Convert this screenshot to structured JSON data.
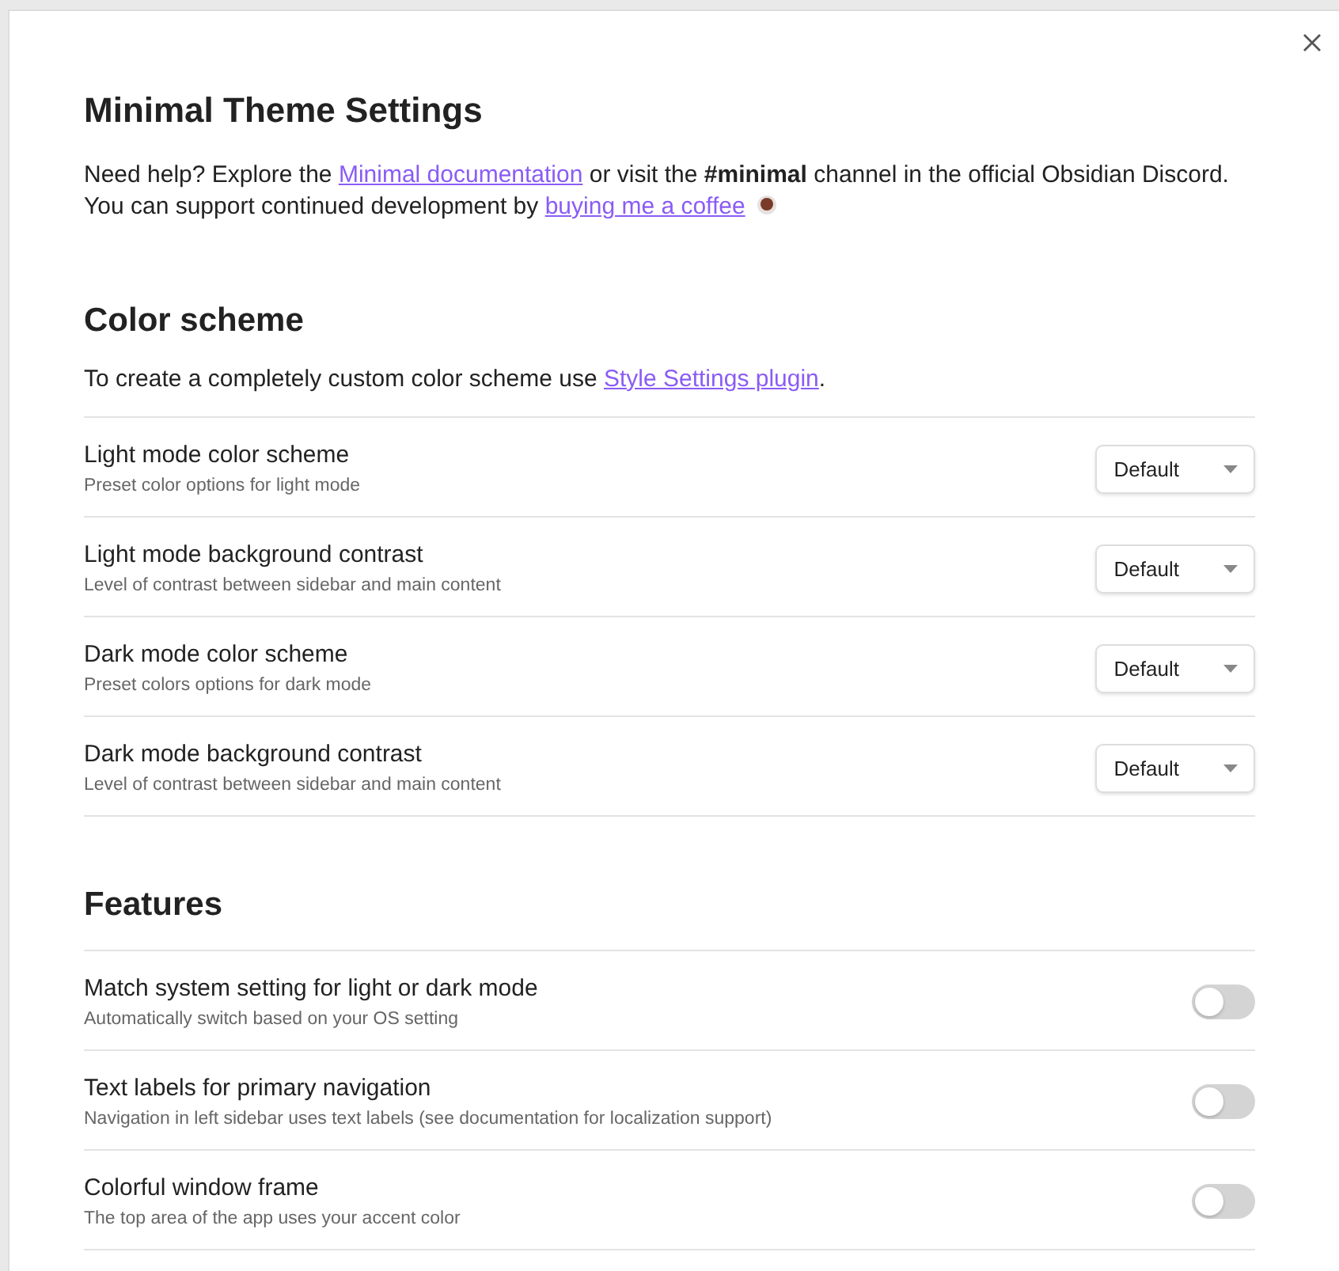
{
  "title": "Minimal Theme Settings",
  "help": [
    [
      {
        "kind": "text",
        "text": "Need help? Explore the "
      },
      {
        "kind": "link",
        "text": "Minimal documentation"
      },
      {
        "kind": "text",
        "text": " or visit the **#minimal** channel in the official Obsidian Discord."
      }
    ],
    [
      {
        "kind": "text",
        "text": "You can support continued development by "
      },
      {
        "kind": "link",
        "text": "buying me a coffee"
      },
      {
        "kind": "icon"
      }
    ]
  ],
  "sections": [
    {
      "heading": "Color scheme",
      "intro": [
        {
          "kind": "text",
          "text": "To create a completely custom color scheme use "
        },
        {
          "kind": "link",
          "text": "Style Settings plugin"
        },
        {
          "kind": "text",
          "text": "."
        }
      ],
      "items": [
        {
          "kind": "dropdown",
          "name": "Light mode color scheme",
          "description": "Preset color options for light mode",
          "value": "Default"
        },
        {
          "kind": "dropdown",
          "name": "Light mode background contrast",
          "description": "Level of contrast between sidebar and main content",
          "value": "Default"
        },
        {
          "kind": "dropdown",
          "name": "Dark mode color scheme",
          "description": "Preset colors options for dark mode",
          "value": "Default"
        },
        {
          "kind": "dropdown",
          "name": "Dark mode background contrast",
          "description": "Level of contrast between sidebar and main content",
          "value": "Default"
        }
      ]
    },
    {
      "heading": "Features",
      "items": [
        {
          "kind": "toggle",
          "name": "Match system setting for light or dark mode",
          "description": "Automatically switch based on your OS setting",
          "on": false
        },
        {
          "kind": "toggle",
          "name": "Text labels for primary navigation",
          "description": "Navigation in left sidebar uses text labels (see documentation for localization support)",
          "on": false
        },
        {
          "kind": "toggle",
          "name": "Colorful window frame",
          "description": "The top area of the app uses your accent color",
          "on": false
        }
      ]
    }
  ]
}
